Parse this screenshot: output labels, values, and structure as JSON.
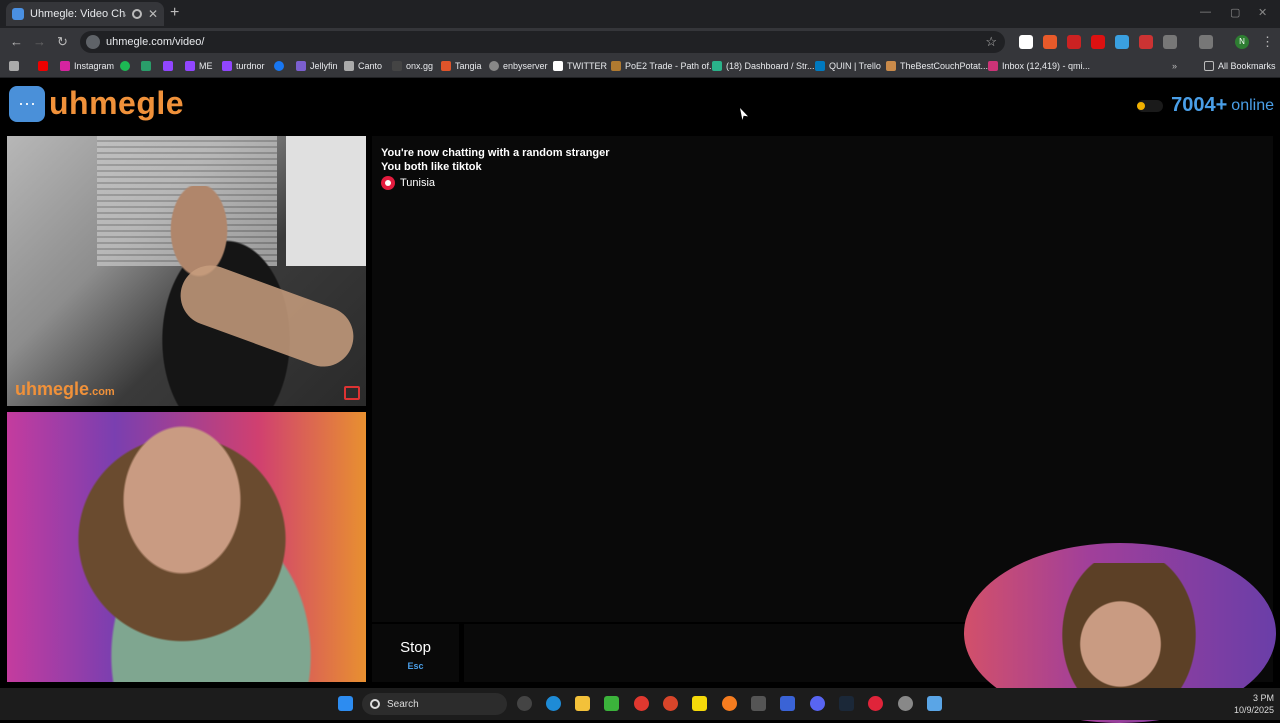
{
  "browser": {
    "tab_title": "Uhmegle: Video Chat | Om…",
    "url": "uhmegle.com/video/",
    "bookmarks": [
      "Instagram",
      "ME",
      "turdnor",
      "Jellyfin",
      "Canto",
      "onx.gg",
      "Tangia",
      "enbyserver",
      "TWITTER",
      "PoE2 Trade - Path of...",
      "(18) Dashboard / Str...",
      "QUIN | Trello",
      "TheBestCouchPotat...",
      "Inbox (12,419) - qmi..."
    ],
    "all_bookmarks": "All Bookmarks",
    "profile_initial": "N"
  },
  "site": {
    "logo_text": "uhmegle",
    "online_count": "7004+",
    "online_label": "online"
  },
  "video": {
    "watermark_main": "uhmegle",
    "watermark_suffix": ".com"
  },
  "chat": {
    "line1": "You're now chatting with a random stranger",
    "line2": "You both like tiktok",
    "country": "Tunisia"
  },
  "controls": {
    "stop_label": "Stop",
    "stop_key": "Esc"
  },
  "taskbar": {
    "search_label": "Search",
    "time": "3 PM",
    "date": "10/9/2025"
  },
  "colors": {
    "brand_orange": "#f0913a",
    "brand_blue": "#4a9fe8",
    "flag_red": "#e31b3e"
  }
}
